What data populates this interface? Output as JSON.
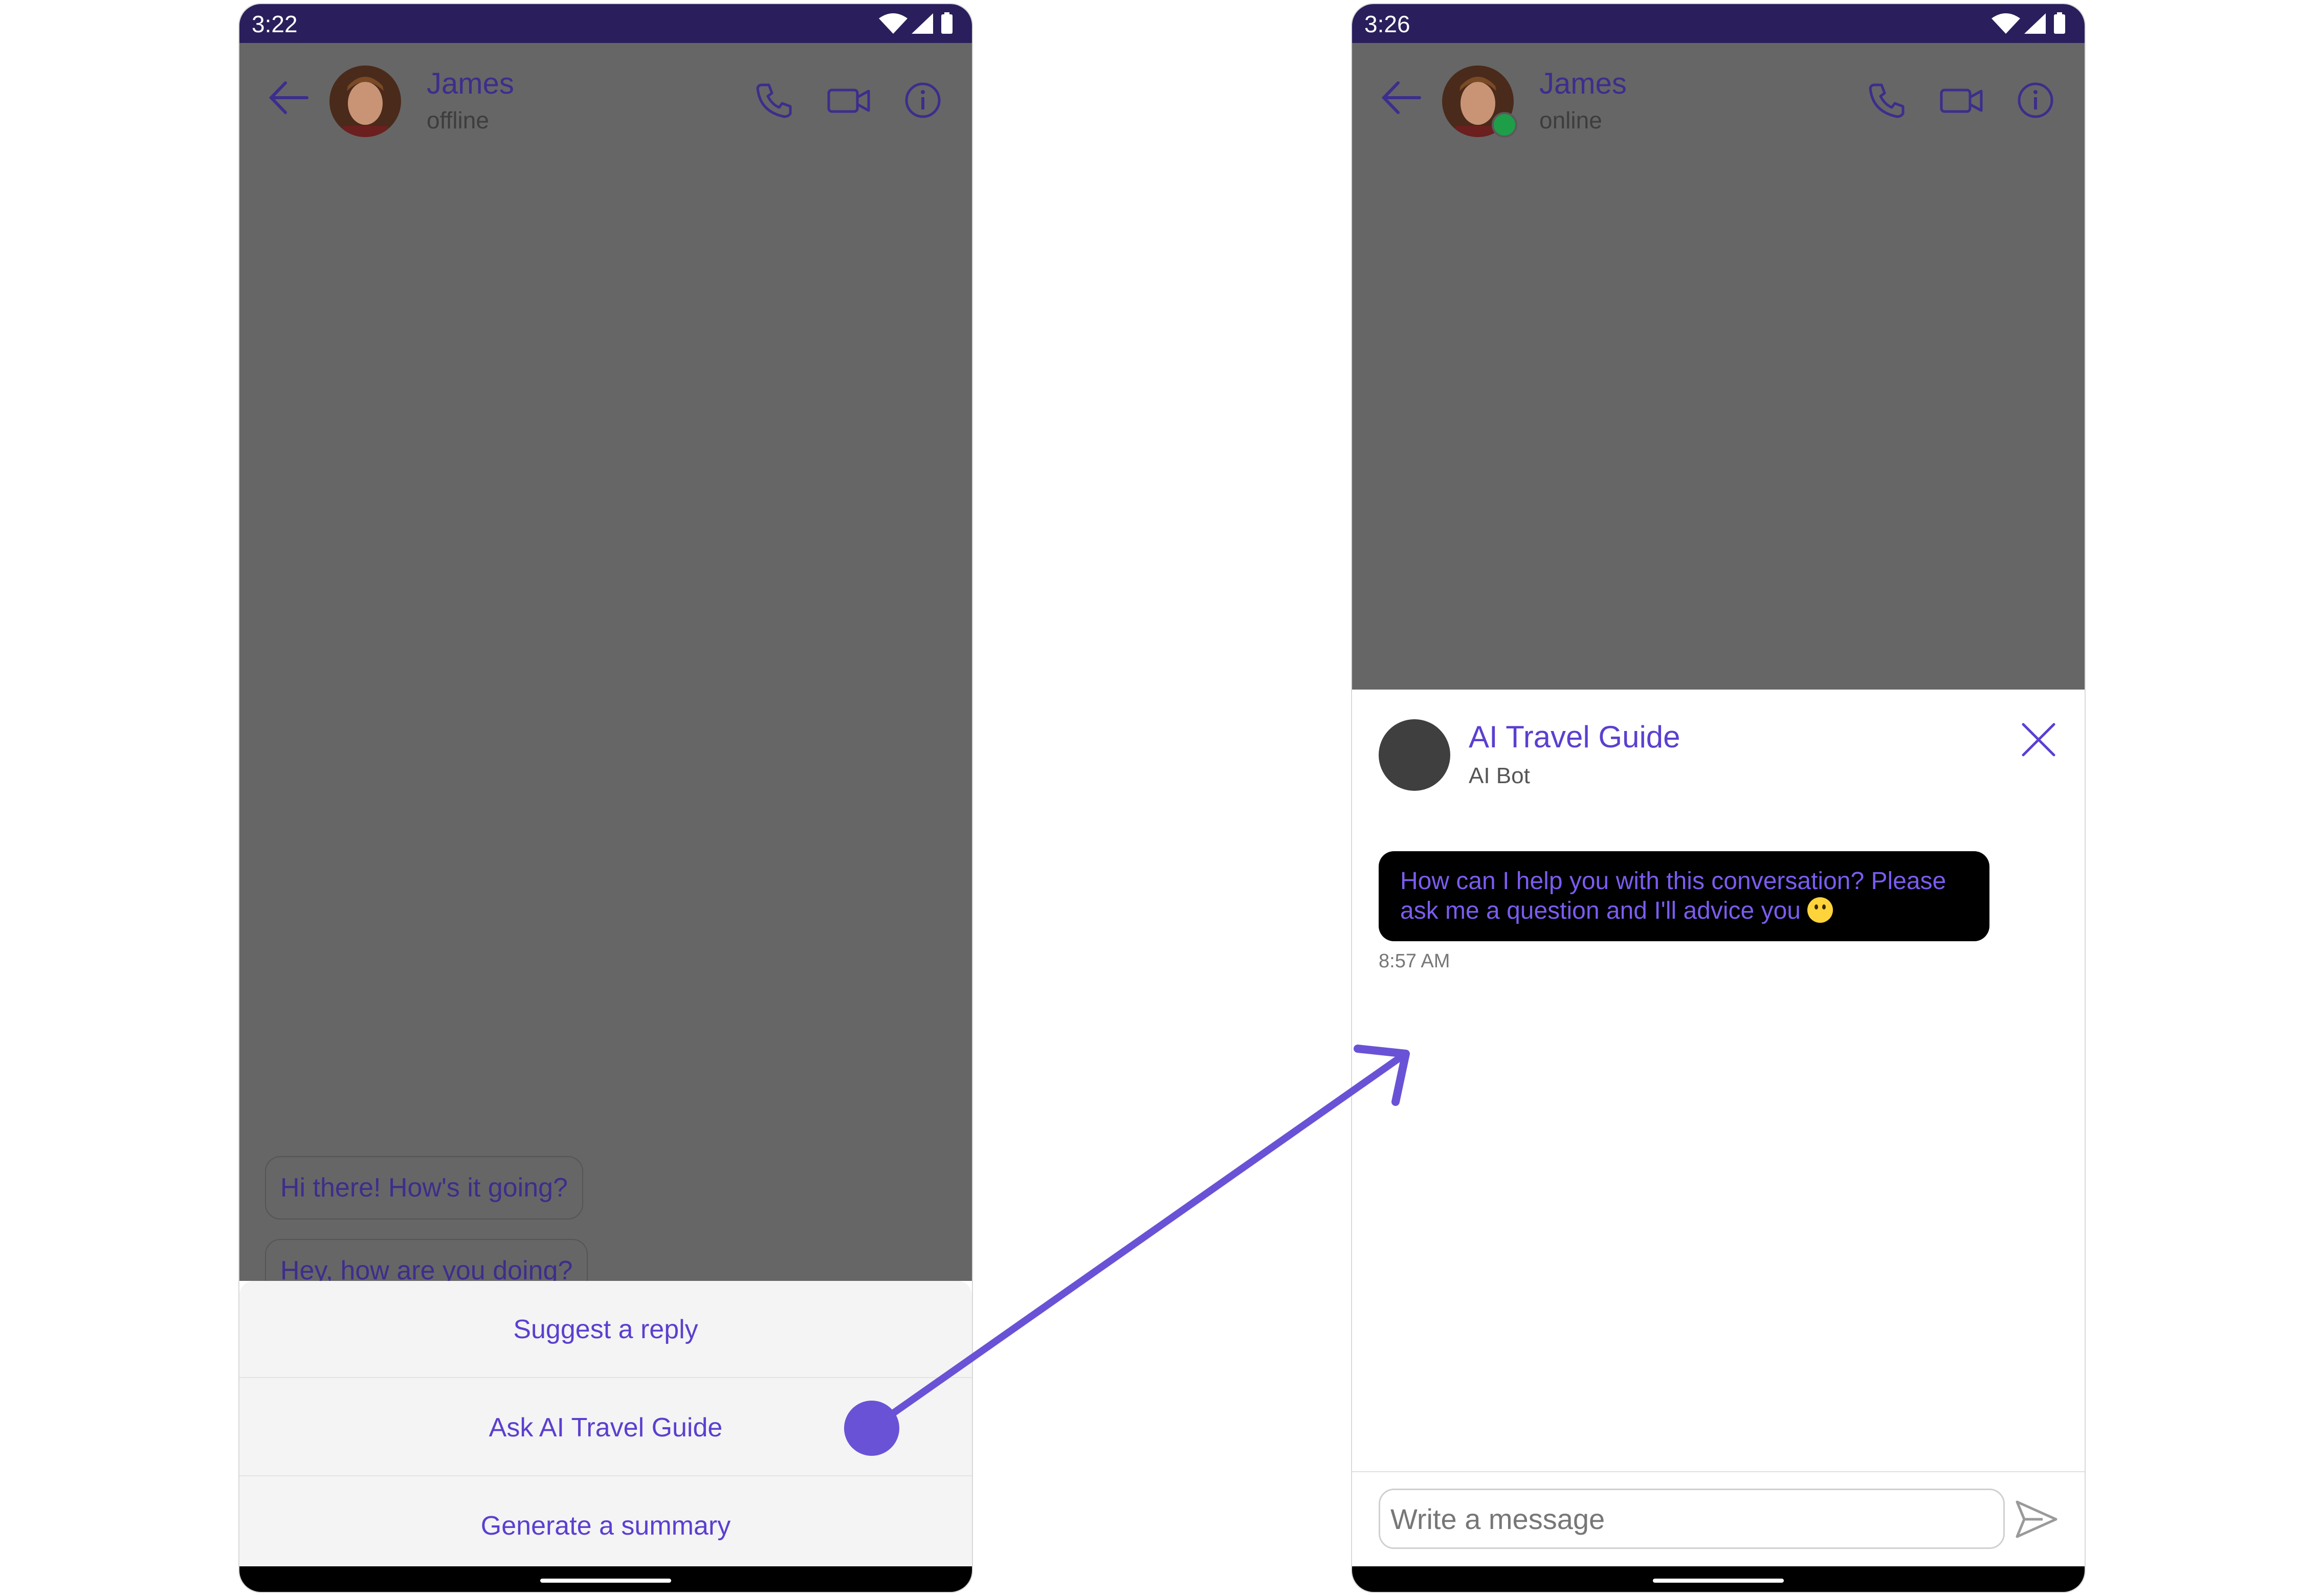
{
  "left_screen": {
    "status_bar": {
      "time": "3:22"
    },
    "header": {
      "name": "James",
      "status": "offline"
    },
    "messages": [
      "Hi there! How's it going?",
      "Hey, how are you doing?"
    ],
    "ai_options": [
      "Suggest a reply",
      "Ask AI Travel Guide",
      "Generate a summary"
    ]
  },
  "right_screen": {
    "status_bar": {
      "time": "3:26"
    },
    "header": {
      "name": "James",
      "status": "online"
    },
    "ai_panel": {
      "title": "AI Travel Guide",
      "subtitle": "AI Bot",
      "message": "How can I help you with this conversation? Please ask me a question and I'll advice you",
      "time": "8:57 AM"
    },
    "composer": {
      "placeholder": "Write a message",
      "value": ""
    }
  },
  "colors": {
    "accent": "#5b3fd0",
    "status_bar": "#2a1f5c",
    "scrim": "#666666",
    "online": "#1f9e4a"
  },
  "icons": [
    "back-arrow-icon",
    "phone-icon",
    "video-icon",
    "info-icon",
    "close-icon",
    "send-icon",
    "wifi-icon",
    "signal-icon",
    "battery-icon"
  ]
}
